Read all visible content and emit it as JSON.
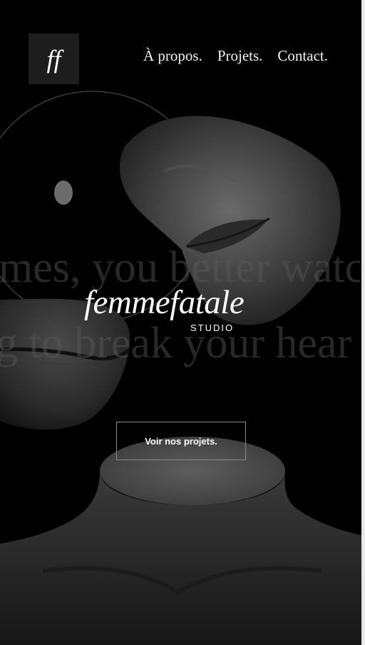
{
  "header": {
    "logo_text": "ff",
    "nav": [
      {
        "label": "À propos."
      },
      {
        "label": "Projets."
      },
      {
        "label": "Contact."
      }
    ]
  },
  "hero": {
    "marquee_line_1": "mes, you better watc",
    "marquee_line_2": "g to break your hear",
    "brand": "femmefatale",
    "brand_sub": "STUDIO",
    "cta_label": "Voir nos projets."
  },
  "colors": {
    "background": "#000000",
    "logo_tile": "#1d1d1d",
    "text": "#ffffff"
  }
}
